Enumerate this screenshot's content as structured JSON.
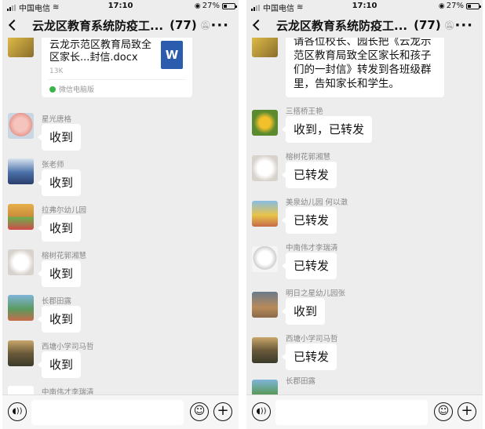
{
  "status": {
    "carrier": "中国电信",
    "time": "17:10",
    "battery": "27%",
    "battery_level": 0.27
  },
  "header": {
    "title": "云龙区教育系统防疫工...",
    "count": "(77)"
  },
  "left": {
    "file": {
      "name": "云龙示范区教育局致全区家长...封信.docx",
      "size": "13K",
      "source": "微信电脑版",
      "icon_letter": "W"
    },
    "messages": [
      {
        "sender": "星光唐格",
        "text": "收到"
      },
      {
        "sender": "张老师",
        "text": "收到"
      },
      {
        "sender": "拉弗尔幼儿园",
        "text": "收到"
      },
      {
        "sender": "榕树花郭湘慧",
        "text": "收到"
      },
      {
        "sender": "长郡田露",
        "text": "收到"
      },
      {
        "sender": "西塘小学司马哲",
        "text": "收到"
      },
      {
        "sender": "中南伟才李瑞清",
        "text": ""
      }
    ]
  },
  "right": {
    "notice": "请各位校长、园长把《云龙示范区教育局致全区家长和孩子们的一封信》转发到各班级群里，告知家长和学生。",
    "messages": [
      {
        "sender": "三搭桥王艳",
        "text": "收到，已转发"
      },
      {
        "sender": "榕树花郭湘慧",
        "text": "已转发"
      },
      {
        "sender": "美泉幼儿园  何以澂",
        "text": "已转发"
      },
      {
        "sender": "中南伟才李瑞清",
        "text": "已转发"
      },
      {
        "sender": "明日之星幼儿园张",
        "text": "收到"
      },
      {
        "sender": "西塘小学司马哲",
        "text": "已转发"
      },
      {
        "sender": "长郡田露",
        "text": ""
      }
    ]
  },
  "icons": {
    "back": "back-chevron-icon",
    "mute": "mute-bell-icon",
    "more": "more-dots-icon",
    "voice": "voice-icon",
    "emoji": "emoji-icon",
    "plus": "plus-icon",
    "wifi": "wifi-icon",
    "lock": "orientation-lock-icon"
  }
}
